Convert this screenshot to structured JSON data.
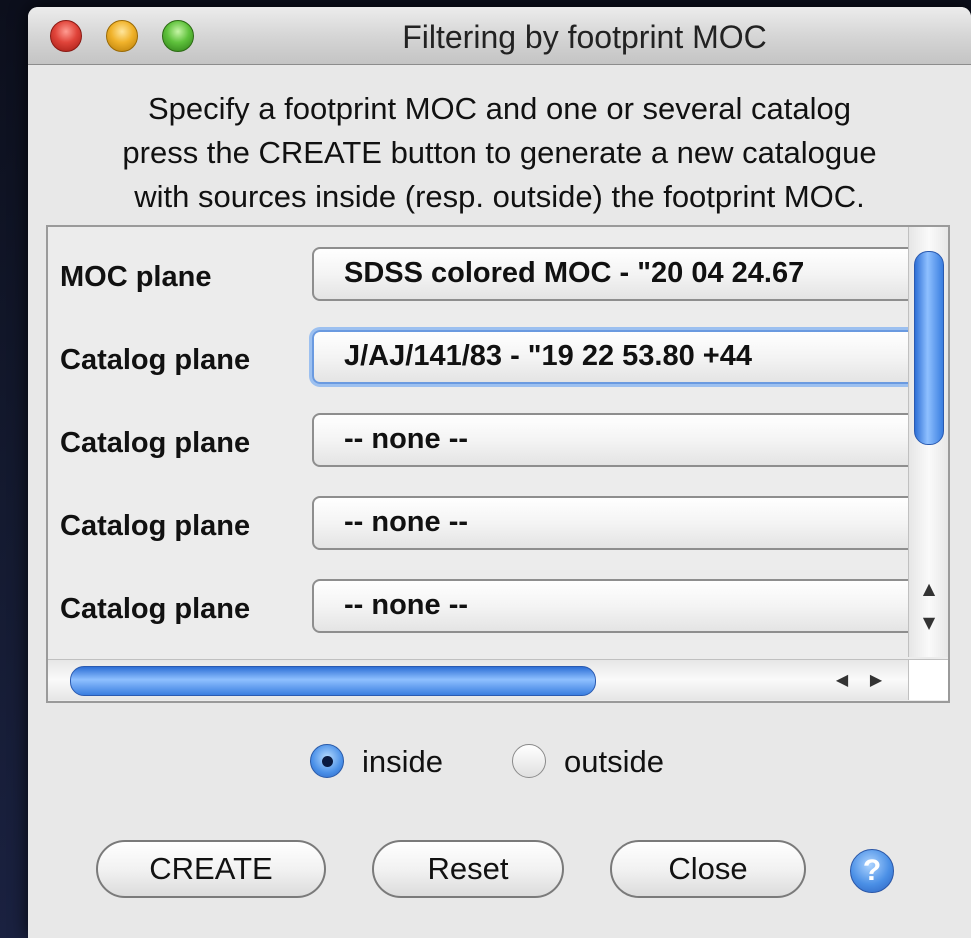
{
  "window": {
    "title": "Filtering by footprint MOC"
  },
  "description": {
    "lines": [
      "Specify a footprint MOC and one or several catalog",
      "press the CREATE button to generate a new catalogue",
      "with sources inside (resp. outside) the footprint MOC."
    ]
  },
  "planes": [
    {
      "label": "MOC plane",
      "value": "SDSS colored MOC - \"20 04 24.67"
    },
    {
      "label": "Catalog plane",
      "value": "J/AJ/141/83 - \"19 22 53.80 +44"
    },
    {
      "label": "Catalog plane",
      "value": "-- none --"
    },
    {
      "label": "Catalog plane",
      "value": "-- none --"
    },
    {
      "label": "Catalog plane",
      "value": "-- none --"
    }
  ],
  "mode": {
    "options": [
      "inside",
      "outside"
    ],
    "selected": "inside"
  },
  "buttons": {
    "create": "CREATE",
    "reset": "Reset",
    "close": "Close",
    "help": "?"
  },
  "scroll_arrows": {
    "up": "▲",
    "down": "▼",
    "left": "◀",
    "right": "▶"
  }
}
